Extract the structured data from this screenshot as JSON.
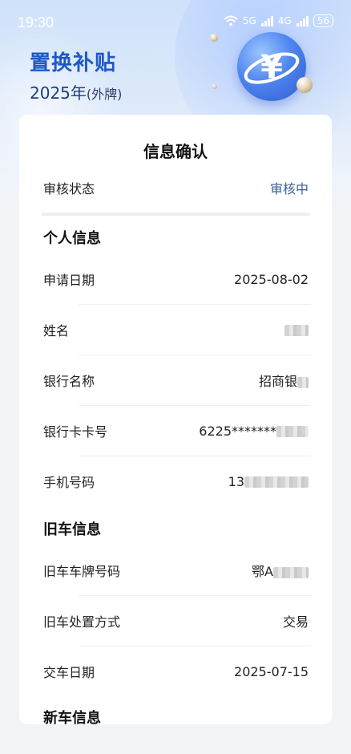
{
  "status_bar": {
    "time": "19:30",
    "network_1": "5G",
    "network_2": "4G",
    "battery": "56"
  },
  "hero": {
    "title": "置换补贴",
    "year": "2025年",
    "tag": "(外牌)",
    "coin_symbol": "¥",
    "accent_color": "#1e58c8"
  },
  "card": {
    "title": "信息确认",
    "review": {
      "label": "审核状态",
      "value": "审核中"
    },
    "personal": {
      "heading": "个人信息",
      "rows": [
        {
          "label": "申请日期",
          "value": "2025-08-02"
        },
        {
          "label": "姓名",
          "value": ""
        },
        {
          "label": "银行名称",
          "value": "招商银"
        },
        {
          "label": "银行卡卡号",
          "value": "6225*******"
        },
        {
          "label": "手机号码",
          "value": "13"
        }
      ]
    },
    "old_car": {
      "heading": "旧车信息",
      "rows": [
        {
          "label": "旧车车牌号码",
          "value": "鄂A"
        },
        {
          "label": "旧车处置方式",
          "value": "交易"
        },
        {
          "label": "交车日期",
          "value": "2025-07-15"
        }
      ]
    },
    "new_car_heading": "新车信息"
  }
}
